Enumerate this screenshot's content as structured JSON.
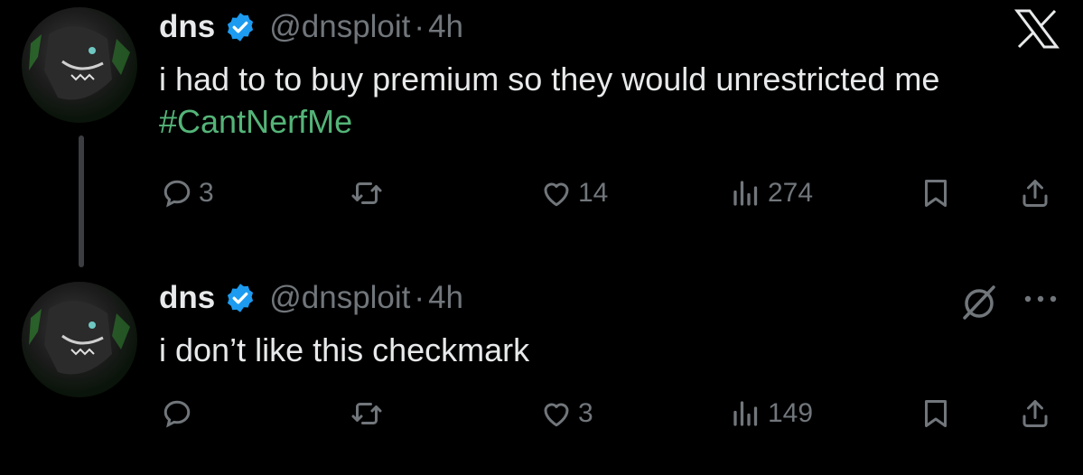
{
  "tweets": [
    {
      "name": "dns",
      "handle": "@dnsploit",
      "dot": "·",
      "time": "4h",
      "text_plain": "i had to to buy premium so they would unrestricted me ",
      "hashtag": "#CantNerfMe",
      "actions": {
        "reply_count": "3",
        "retweet_count": "",
        "like_count": "14",
        "view_count": "274"
      }
    },
    {
      "name": "dns",
      "handle": "@dnsploit",
      "dot": "·",
      "time": "4h",
      "text_plain": "i don’t like this checkmark",
      "actions": {
        "reply_count": "",
        "retweet_count": "",
        "like_count": "3",
        "view_count": "149"
      }
    }
  ],
  "icons": {
    "verified": "verified-badge-icon",
    "x_logo": "x-logo-icon",
    "mute": "mute-icon",
    "more": "more-icon",
    "reply": "reply-icon",
    "retweet": "retweet-icon",
    "like": "heart-icon",
    "views": "views-icon",
    "bookmark": "bookmark-icon",
    "share": "share-icon"
  },
  "colors": {
    "background": "#000000",
    "text": "#e7e9ea",
    "muted": "#71767b",
    "hashtag": "#54b478",
    "verified": "#1d9bf0"
  }
}
